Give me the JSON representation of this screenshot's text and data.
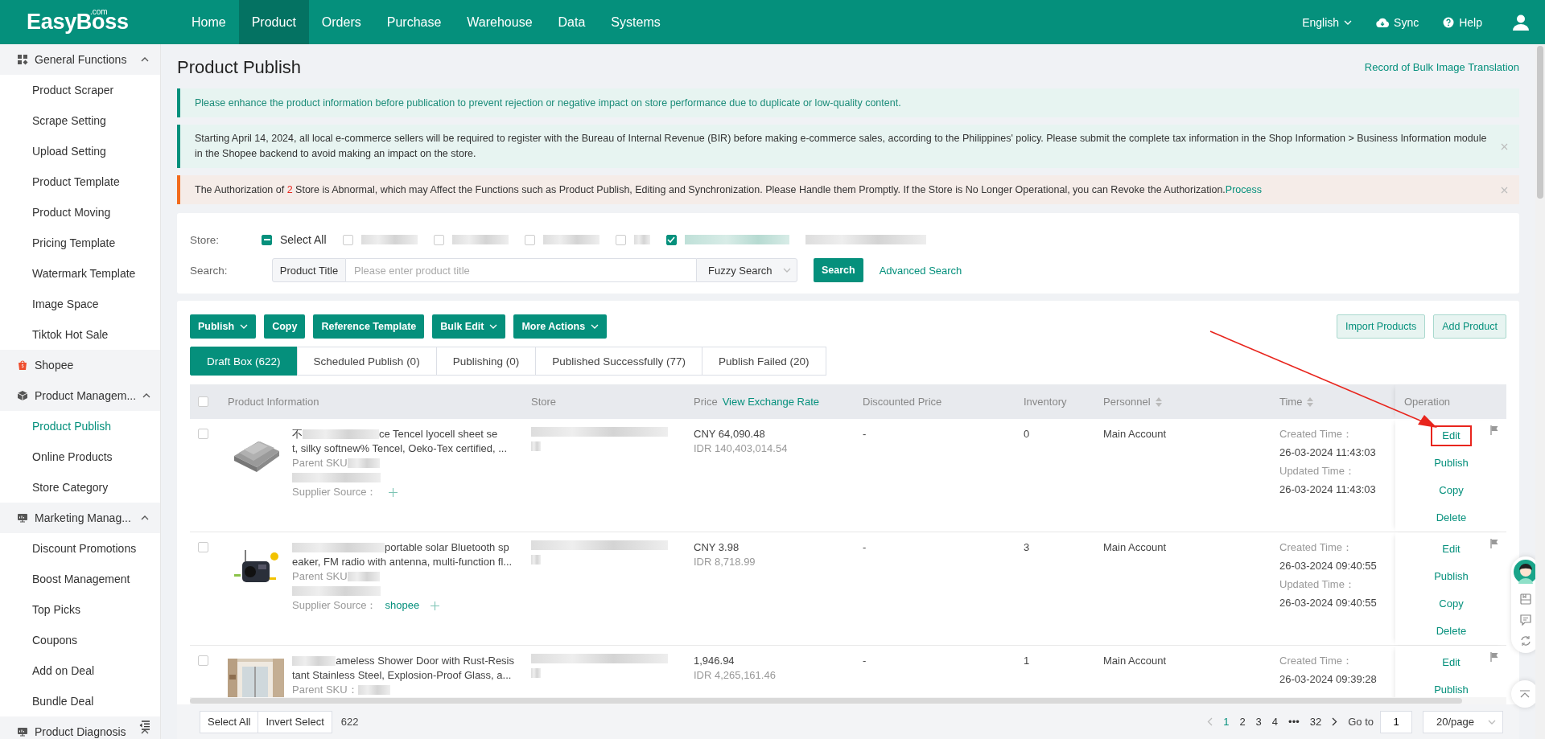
{
  "header": {
    "logo": "EasyBoss",
    "logo_suffix": ".com",
    "nav": [
      {
        "label": "Home",
        "selected": false
      },
      {
        "label": "Product",
        "selected": true
      },
      {
        "label": "Orders",
        "selected": false
      },
      {
        "label": "Purchase",
        "selected": false
      },
      {
        "label": "Warehouse",
        "selected": false
      },
      {
        "label": "Data",
        "selected": false
      },
      {
        "label": "Systems",
        "selected": false
      }
    ],
    "language": "English",
    "sync": "Sync",
    "help": "Help"
  },
  "sidebar": {
    "groups": [
      {
        "kind": "functions",
        "label": "General Functions",
        "expanded": true,
        "children": [
          {
            "label": "Product Scraper",
            "selected": false
          },
          {
            "label": "Scrape Setting",
            "selected": false
          },
          {
            "label": "Upload Setting",
            "selected": false
          },
          {
            "label": "Product Template",
            "selected": false
          },
          {
            "label": "Product Moving",
            "selected": false
          },
          {
            "label": "Pricing Template",
            "selected": false
          },
          {
            "label": "Watermark Template",
            "selected": false
          },
          {
            "label": "Image Space",
            "selected": false
          },
          {
            "label": "Tiktok Hot Sale",
            "selected": false
          }
        ]
      },
      {
        "kind": "shop",
        "label": "Shopee"
      },
      {
        "kind": "box",
        "label": "Product Managem...",
        "expanded": true,
        "children": [
          {
            "label": "Product Publish",
            "selected": true
          },
          {
            "label": "Online Products",
            "selected": false
          },
          {
            "label": "Store Category",
            "selected": false
          }
        ]
      },
      {
        "kind": "board",
        "label": "Marketing Manag...",
        "expanded": true,
        "children": [
          {
            "label": "Discount Promotions",
            "selected": false
          },
          {
            "label": "Boost Management",
            "selected": false
          },
          {
            "label": "Top Picks",
            "selected": false
          },
          {
            "label": "Coupons",
            "selected": false
          },
          {
            "label": "Add on Deal",
            "selected": false
          },
          {
            "label": "Bundle Deal",
            "selected": false
          }
        ]
      },
      {
        "kind": "board",
        "label": "Product Diagnosis",
        "expanded": true
      }
    ]
  },
  "page": {
    "title": "Product Publish",
    "top_link": "Record of Bulk Image Translation"
  },
  "notices": [
    {
      "kind": "info",
      "closable": false,
      "parts": [
        {
          "kind": "text",
          "text": "Please enhance the product information before publication to prevent rejection or negative impact on store performance due to duplicate or low-quality content."
        }
      ]
    },
    {
      "kind": "plain",
      "closable": true,
      "parts": [
        {
          "kind": "text",
          "text": "Starting April 14, 2024, all local e-commerce sellers will be required to register with the Bureau of Internal Revenue (BIR) before making e-commerce sales, according to the Philippines' policy. Please submit the complete tax information in the Shop Information > Business Information module in the Shopee backend to avoid making an impact on the store."
        }
      ]
    },
    {
      "kind": "warning",
      "closable": true,
      "parts": [
        {
          "kind": "text",
          "text": "The Authorization of "
        },
        {
          "kind": "count",
          "text": "2"
        },
        {
          "kind": "text",
          "text": " Store is Abnormal, which may Affect the Functions such as Product Publish, Editing and Synchronization. Please Handle them Promptly. If the Store is No Longer Operational, you can Revoke the Authorization."
        },
        {
          "kind": "link",
          "text": "Process"
        }
      ]
    }
  ],
  "filters": {
    "store_label": "Store:",
    "select_all": {
      "label": "Select All",
      "indeterminate": true
    },
    "stores": [
      {
        "checked": false
      },
      {
        "checked": false
      },
      {
        "checked": false
      },
      {
        "checked": false
      },
      {
        "checked": true
      }
    ],
    "search_label": "Search:",
    "field_type": "Product Title",
    "placeholder": "Please enter product title",
    "mode": "Fuzzy Search",
    "search_button": "Search",
    "advanced": "Advanced Search"
  },
  "toolbar": {
    "actions": [
      {
        "label": "Publish",
        "dropdown": true
      },
      {
        "label": "Copy",
        "dropdown": false
      },
      {
        "label": "Reference Template",
        "dropdown": false
      },
      {
        "label": "Bulk Edit",
        "dropdown": true
      },
      {
        "label": "More Actions",
        "dropdown": true
      }
    ],
    "right_actions": [
      "Import Products",
      "Add Product"
    ]
  },
  "tabs": [
    {
      "label": "Draft Box (622)",
      "selected": true
    },
    {
      "label": "Scheduled Publish (0)",
      "selected": false
    },
    {
      "label": "Publishing (0)",
      "selected": false
    },
    {
      "label": "Published Successfully (77)",
      "selected": false
    },
    {
      "label": "Publish Failed (20)",
      "selected": false
    }
  ],
  "table": {
    "select_all_checked": false,
    "columns": [
      {
        "label": "Product Information",
        "sortable": false
      },
      {
        "label": "Store",
        "sortable": false
      },
      {
        "label": "Price",
        "link": "View Exchange Rate",
        "sortable": false
      },
      {
        "label": "Discounted Price",
        "sortable": false
      },
      {
        "label": "Inventory",
        "sortable": false
      },
      {
        "label": "Personnel",
        "sortable": true
      },
      {
        "label": "Time",
        "sortable": true
      },
      {
        "label": "Operation",
        "sortable": false
      }
    ],
    "rows": [
      {
        "checked": false,
        "image": {
          "kind": "picture"
        },
        "title_lead": "不",
        "title_lines": [
          "ce Tencel lyocell sheet se",
          "t, silky softnew% Tencel, Oeko-Tex certified, ..."
        ],
        "sku_label": "Parent SKU",
        "supplier_label": "Supplier Source：",
        "prices": [
          "CNY 64,090.48",
          "IDR 140,403,014.54"
        ],
        "discounted": "-",
        "inventory": "0",
        "personnel": "Main Account",
        "times": [
          {
            "label": "Created Time：",
            "value": "26-03-2024 11:43:03"
          },
          {
            "label": "Updated Time：",
            "value": "26-03-2024 11:43:03"
          }
        ],
        "operations": [
          {
            "label": "Edit",
            "highlighted": true
          },
          {
            "label": "Publish",
            "highlighted": false
          },
          {
            "label": "Copy",
            "highlighted": false
          },
          {
            "label": "Delete",
            "highlighted": false
          }
        ]
      },
      {
        "checked": false,
        "image": {
          "kind": "picture"
        },
        "title_lines": [
          "portable solar Bluetooth sp",
          "eaker, FM radio with antenna, multi-function fl..."
        ],
        "sku_label": "Parent SKU",
        "supplier_label": "Supplier Source：",
        "supplier_value": "shopee",
        "prices": [
          "CNY 3.98",
          "IDR 8,718.99"
        ],
        "discounted": "-",
        "inventory": "3",
        "personnel": "Main Account",
        "times": [
          {
            "label": "Created Time：",
            "value": "26-03-2024 09:40:55"
          },
          {
            "label": "Updated Time：",
            "value": "26-03-2024 09:40:55"
          }
        ],
        "operations": [
          {
            "label": "Edit",
            "highlighted": false
          },
          {
            "label": "Publish",
            "highlighted": false
          },
          {
            "label": "Copy",
            "highlighted": false
          },
          {
            "label": "Delete",
            "highlighted": false
          }
        ]
      },
      {
        "checked": false,
        "image": {
          "kind": "picture"
        },
        "title_lines": [
          "ameless Shower Door with Rust-Resis",
          "tant Stainless Steel, Explosion-Proof Glass, a..."
        ],
        "sku_label": "Parent SKU：",
        "prices": [
          "1,946.94",
          "IDR 4,265,161.46"
        ],
        "discounted": "-",
        "inventory": "1",
        "personnel": "Main Account",
        "times": [
          {
            "label": "Created Time：",
            "value": "26-03-2024 09:39:28"
          }
        ],
        "operations": [
          {
            "label": "Edit",
            "highlighted": false
          },
          {
            "label": "Publish",
            "highlighted": false
          }
        ]
      }
    ]
  },
  "footer": {
    "select_all": "Select All",
    "invert": "Invert Select",
    "count": "622",
    "pages": [
      {
        "label": "1",
        "selected": true
      },
      {
        "label": "2",
        "selected": false
      },
      {
        "label": "3",
        "selected": false
      },
      {
        "label": "4",
        "selected": false
      },
      {
        "label": "•••",
        "selected": false
      },
      {
        "label": "32",
        "selected": false
      }
    ],
    "goto_label": "Go to",
    "goto_value": "1",
    "page_size": "20/page"
  }
}
